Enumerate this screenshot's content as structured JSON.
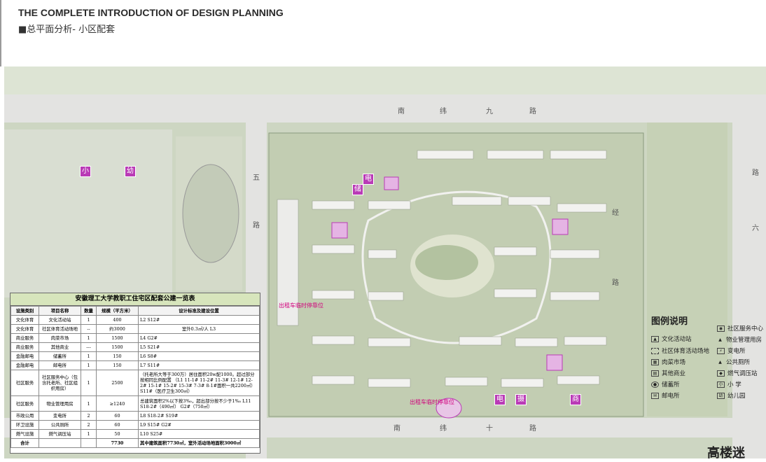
{
  "header": {
    "title": "THE COMPLETE INTRODUCTION OF DESIGN PLANNING",
    "subtitle": "■总平面分析- 小区配套"
  },
  "plan": {
    "road_north": [
      "南",
      "纬",
      "九",
      "路"
    ],
    "road_south": [
      "南",
      "纬",
      "十",
      "路"
    ],
    "road_west": [
      "五",
      "路"
    ],
    "road_mid": [
      "经",
      "路"
    ],
    "road_east": [
      "路",
      "六"
    ],
    "bus_stop_labels": [
      "出租车临时停靠位",
      "出租车临时停靠位"
    ],
    "facility_glyphs": [
      "小",
      "幼",
      "电",
      "储",
      "电",
      "摄",
      "商"
    ],
    "colors": {
      "facility": "#b93ab6",
      "greenery": "#a9bb95",
      "paths": "#eeeeee"
    }
  },
  "table": {
    "title": "安徽理工大学教职工住宅区配套公建一览表",
    "headers": [
      "设施类别",
      "项目名称",
      "数量",
      "规模（平方米）",
      "设计标准及建设位置"
    ],
    "rows": [
      [
        "文化体育",
        "文化活动站",
        "1",
        "400",
        "L2  S12#"
      ],
      [
        "文化体育",
        "社区体育活动场地",
        "--",
        "约3000",
        "室外0.3㎡/人  L3"
      ],
      [
        "商业服务",
        "肉菜市场",
        "1",
        "1500",
        "L4  G2#"
      ],
      [
        "商业服务",
        "其他商业",
        "---",
        "1500",
        "L5  S21#"
      ],
      [
        "金融邮电",
        "储蓄所",
        "1",
        "150",
        "L6  S8#"
      ],
      [
        "金融邮电",
        "邮电所",
        "1",
        "150",
        "L7  S11#"
      ],
      [
        "社区服务",
        "社区服务中心（包含托老所、社区组织用房）",
        "1",
        "2500",
        "（托老所大等于300万）居住面积20w配1000。超过部分按相同比例配置 （L1 11-1# 11-2# 11-3# 12-1# 12-2# 15-1# 15-2# 15-3# 7-3# 8-1#面积一共2200㎡）  S11#（医疗卫生300㎡）"
      ],
      [
        "社区服务",
        "物业管理用房",
        "1",
        "≥1240",
        "总建筑面积2%以下按3‰，超出部分按不少于1‰ L11 S18-2#（490㎡）  G2#（750㎡）"
      ],
      [
        "市政公用",
        "变电所",
        "2",
        "60",
        "L8  S18-2#  S19#"
      ],
      [
        "环卫设施",
        "公共厕所",
        "2",
        "60",
        "L9  S15#  G2#"
      ],
      [
        "燃气设施",
        "燃气调压站",
        "1",
        "50",
        "L10  S25#"
      ]
    ],
    "total": [
      "合计",
      "",
      "",
      "7730",
      "其中建筑面积7730㎡，室外活动场地面积3000㎡"
    ]
  },
  "legend": {
    "title": "图例说明",
    "items": [
      {
        "icon": "triangle-flag-icon",
        "label": "文化活动站"
      },
      {
        "icon": "dashed-rect-icon",
        "label": "社区体育活动场地"
      },
      {
        "icon": "market-icon",
        "label": "肉菜市场"
      },
      {
        "icon": "shop-icon",
        "label": "其他商业"
      },
      {
        "icon": "savings-icon",
        "label": "储蓄所"
      },
      {
        "icon": "post-icon",
        "label": "邮电所"
      },
      {
        "icon": "service-center-icon",
        "label": "社区服务中心"
      },
      {
        "icon": "property-icon",
        "label": "物业管理用房"
      },
      {
        "icon": "substation-icon",
        "label": "变电所"
      },
      {
        "icon": "toilet-icon",
        "label": "公共厕所"
      },
      {
        "icon": "gas-icon",
        "label": "燃气调压站"
      },
      {
        "icon": "primary-school-icon",
        "label": "小  学",
        "glyph": "小"
      },
      {
        "icon": "kindergarten-icon",
        "label": "幼儿园",
        "glyph": "幼"
      }
    ]
  },
  "brand": "高楼迷"
}
